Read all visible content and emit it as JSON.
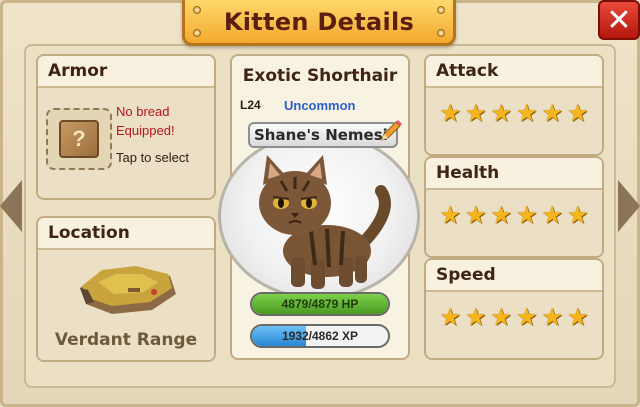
{
  "header": {
    "title": "Kitten Details",
    "close_label": "✕"
  },
  "armor": {
    "title": "Armor",
    "status_line1": "No bread",
    "status_line2": "Equipped!",
    "hint": "Tap to select",
    "slot_icon": "?"
  },
  "location": {
    "title": "Location",
    "name": "Verdant Range"
  },
  "kitten": {
    "breed": "Exotic Shorthair",
    "level": "L24",
    "rarity": "Uncommon",
    "name": "Shane's Nemesi",
    "hp": {
      "text": "4879/4879 HP",
      "current": 4879,
      "max": 4879
    },
    "xp": {
      "text": "1932/4862 XP",
      "current": 1932,
      "max": 4862
    }
  },
  "stats": [
    {
      "title": "Attack",
      "stars": 6
    },
    {
      "title": "Health",
      "stars": 6
    },
    {
      "title": "Speed",
      "stars": 6
    }
  ],
  "colors": {
    "accent": "#f3a92e",
    "hp_fill": "#5fb12d",
    "xp_fill": "#3a9be0",
    "star": "#f6b51a",
    "rarity": "#2b62c9"
  }
}
